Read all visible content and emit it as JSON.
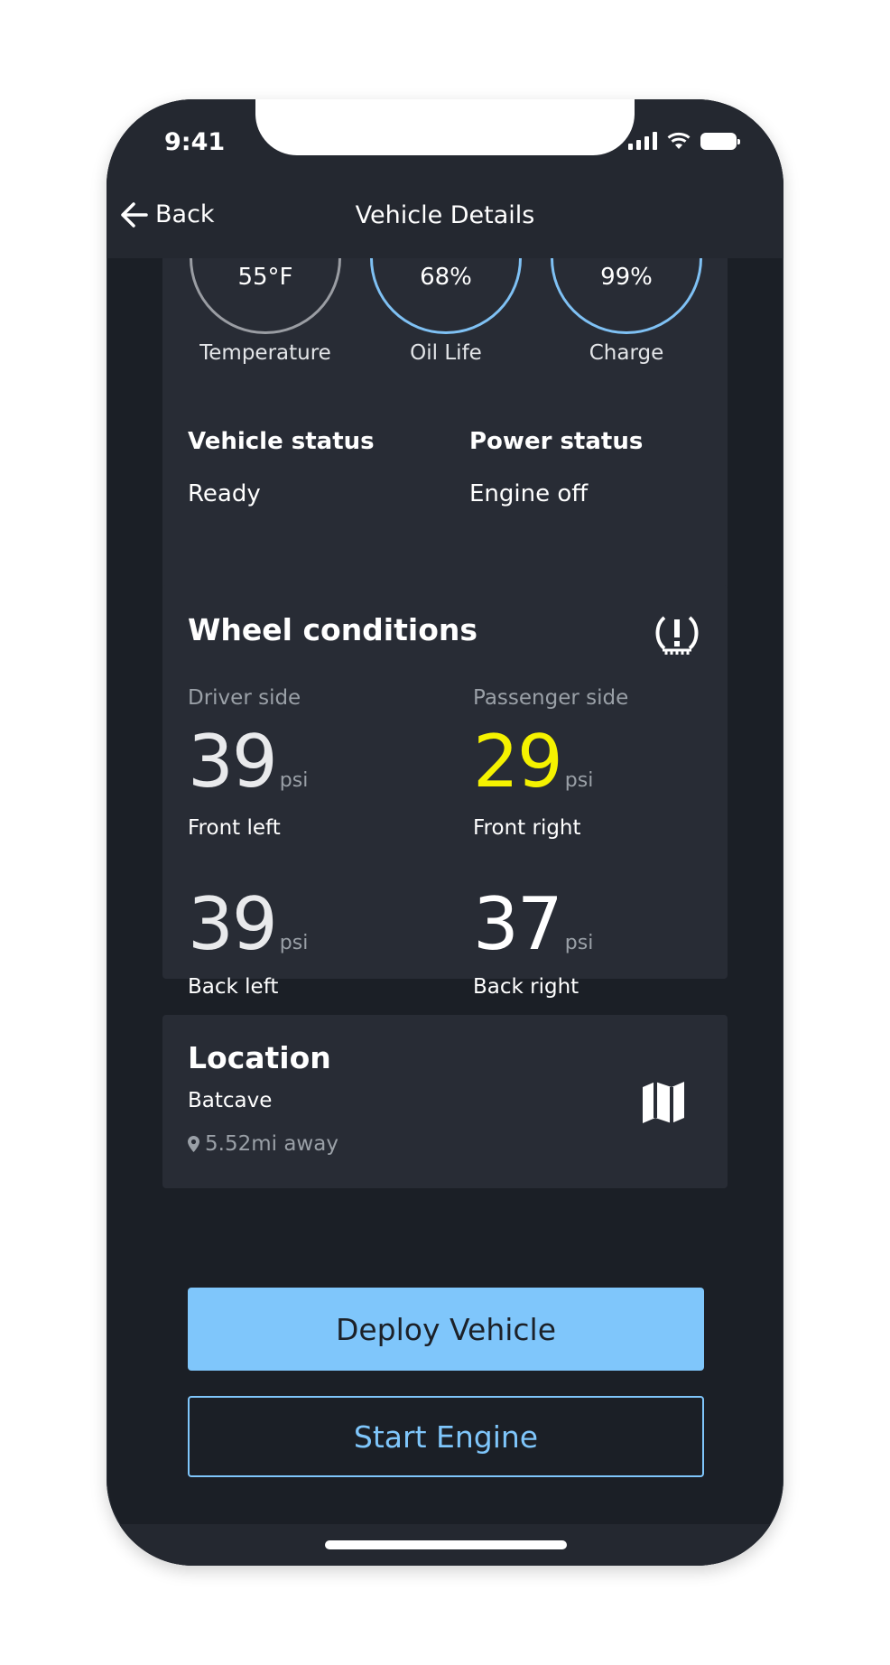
{
  "status_bar": {
    "time": "9:41"
  },
  "nav": {
    "back_label": "Back",
    "title": "Vehicle Details"
  },
  "gauges": [
    {
      "value": "55°F",
      "label": "Temperature",
      "color": "#9a9da3"
    },
    {
      "value": "68%",
      "label": "Oil Life",
      "color": "#7fc1f4"
    },
    {
      "value": "99%",
      "label": "Charge",
      "color": "#7fc1f4"
    }
  ],
  "vehicle_status": {
    "heading": "Vehicle status",
    "value": "Ready"
  },
  "power_status": {
    "heading": "Power status",
    "value": "Engine off"
  },
  "wheels": {
    "title": "Wheel conditions",
    "driver_side": "Driver side",
    "passenger_side": "Passenger side",
    "unit": "psi",
    "front_left": {
      "value": "39",
      "label": "Front left"
    },
    "front_right": {
      "value": "29",
      "label": "Front right",
      "color": "#f5f200"
    },
    "back_left": {
      "value": "39",
      "label": "Back left"
    },
    "back_right": {
      "value": "37",
      "label": "Back right"
    }
  },
  "location": {
    "title": "Location",
    "name": "Batcave",
    "distance": "5.52mi away"
  },
  "actions": {
    "deploy": "Deploy Vehicle",
    "start": "Start Engine"
  },
  "colors": {
    "accent": "#7fc6fb",
    "warning": "#f5f200",
    "background": "#1b1f26",
    "card": "#282c35"
  }
}
